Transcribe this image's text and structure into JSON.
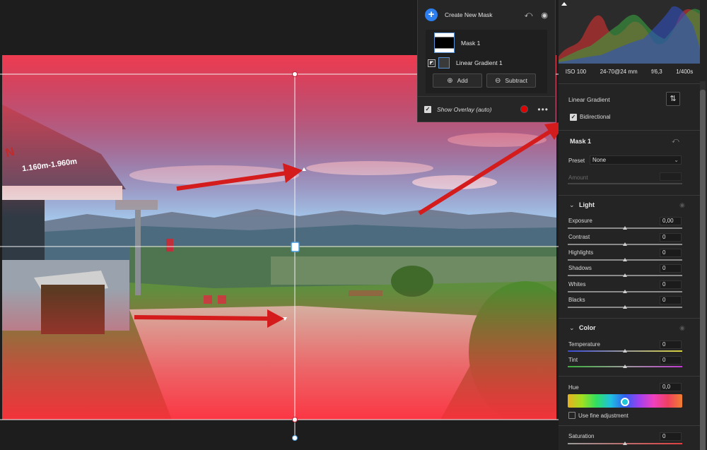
{
  "masks_panel": {
    "create_label": "Create New Mask",
    "plus_glyph": "+",
    "undo_glyph": "⤺",
    "eye_glyph": "◉",
    "mask_name": "Mask 1",
    "component_name": "Linear Gradient 1",
    "add_label": "Add",
    "subtract_label": "Subtract",
    "show_overlay_label": "Show Overlay (auto)",
    "overlay_color": "#e00000",
    "more_glyph": "•••"
  },
  "histogram": {
    "iso": "ISO 100",
    "lens": "24-70@24 mm",
    "aperture": "f/6,3",
    "shutter": "1/400s"
  },
  "gradient_tool": {
    "title": "Linear Gradient",
    "bidirectional_label": "Bidirectional",
    "bidirectional_checked": true
  },
  "mask_settings": {
    "title": "Mask 1",
    "preset_label": "Preset",
    "preset_value": "None",
    "amount_label": "Amount"
  },
  "light": {
    "title": "Light",
    "sliders": [
      {
        "label": "Exposure",
        "value": "0,00"
      },
      {
        "label": "Contrast",
        "value": "0"
      },
      {
        "label": "Highlights",
        "value": "0"
      },
      {
        "label": "Shadows",
        "value": "0"
      },
      {
        "label": "Whites",
        "value": "0"
      },
      {
        "label": "Blacks",
        "value": "0"
      }
    ]
  },
  "color": {
    "title": "Color",
    "temperature_label": "Temperature",
    "temperature_value": "0",
    "tint_label": "Tint",
    "tint_value": "0",
    "hue_label": "Hue",
    "hue_value": "0,0",
    "fine_adjust_label": "Use fine adjustment",
    "saturation_label": "Saturation",
    "saturation_value": "0"
  },
  "photo_sign": {
    "line1": "N",
    "line2": "1.160m-1.960m"
  }
}
